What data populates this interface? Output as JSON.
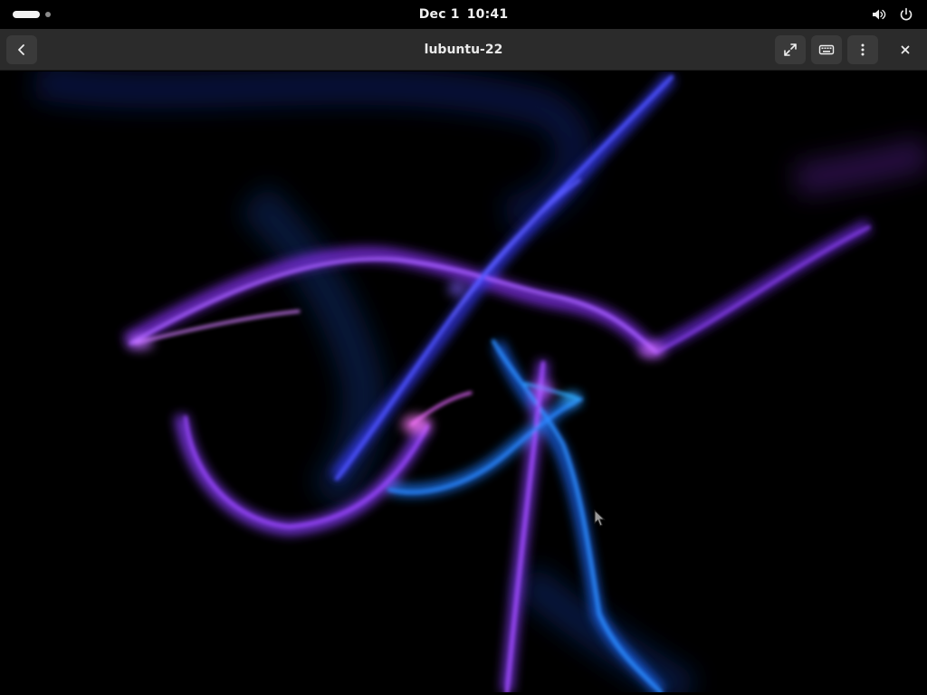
{
  "topbar": {
    "date": "Dec 1",
    "time": "10:41",
    "workspace_icon": "workspace-indicator",
    "tray_icons": [
      "volume-icon",
      "power-icon"
    ]
  },
  "headerbar": {
    "title": "lubuntu-22",
    "buttons": {
      "back": "back-arrow-icon",
      "fullscreen": "fullscreen-icon",
      "keyboard": "keyboard-icon",
      "menu": "vertical-dots-icon",
      "close": "close-icon"
    }
  },
  "remote_desktop": {
    "content": "wallpaper",
    "colors": {
      "purple": "#9b3cff",
      "blue": "#2f5cff",
      "cyan": "#1f8fff",
      "magenta": "#e05cff"
    }
  }
}
